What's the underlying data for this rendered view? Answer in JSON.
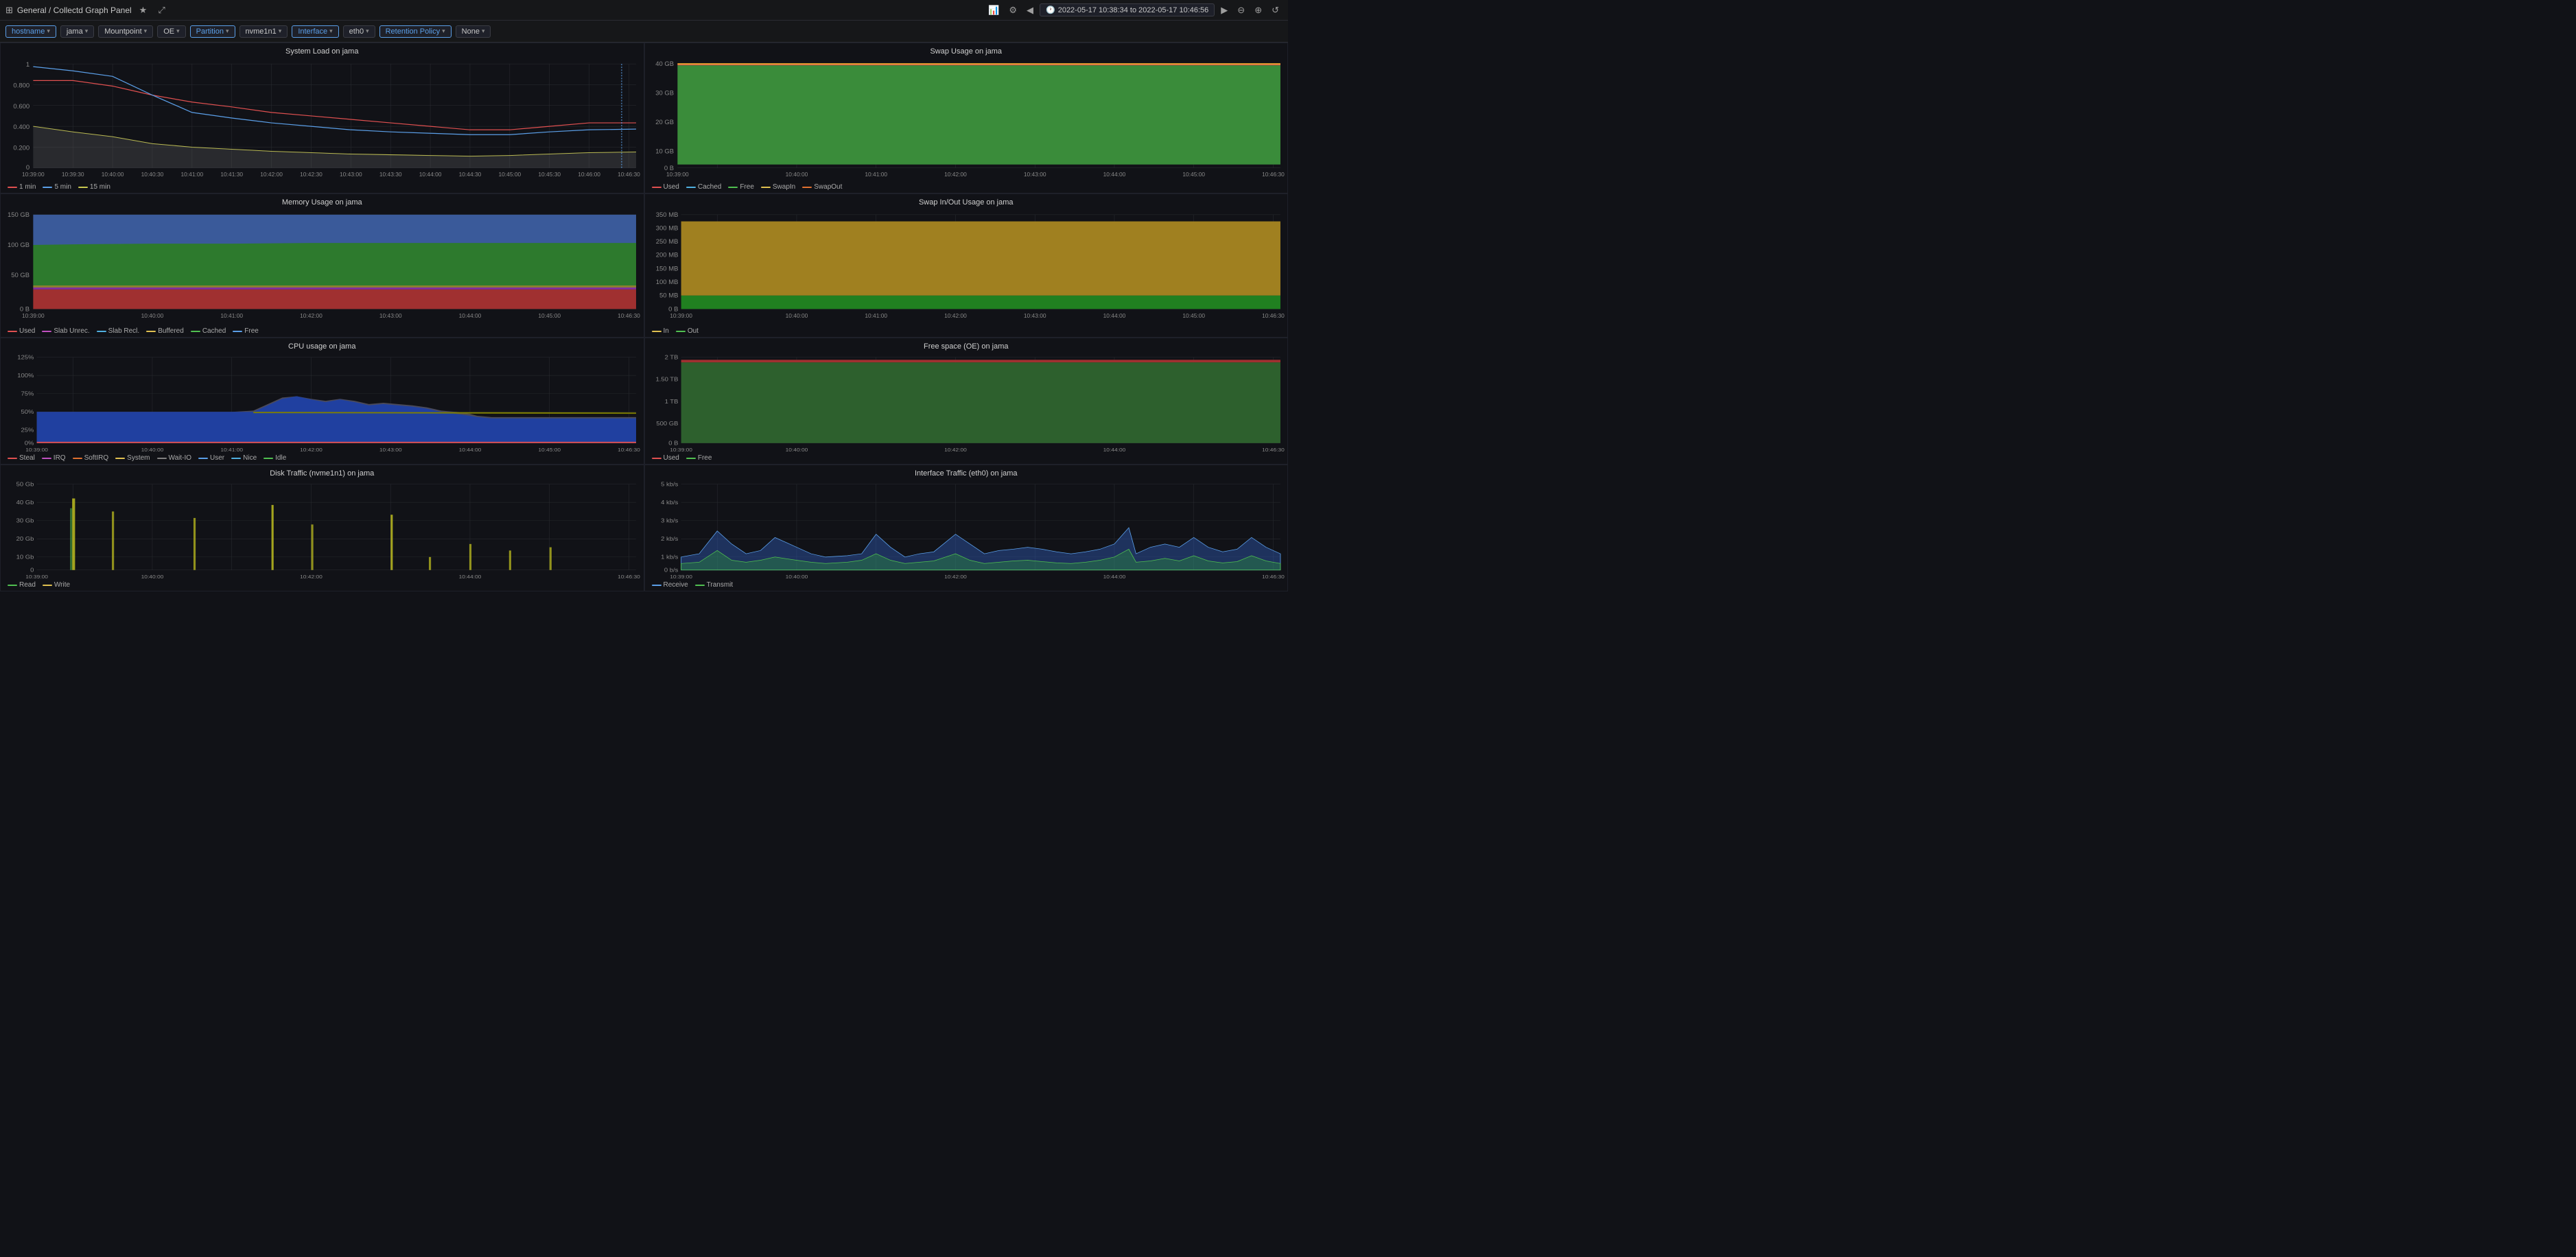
{
  "topbar": {
    "title": "General / Collectd Graph Panel",
    "star_icon": "★",
    "share_icon": "⤢",
    "time_range": "2022-05-17 10:38:34 to 2022-05-17 10:46:56",
    "zoom_in": "⊕",
    "refresh": "↺"
  },
  "filters": [
    {
      "id": "hostname",
      "label": "hostname",
      "value": "",
      "active": true
    },
    {
      "id": "jama",
      "label": "jama",
      "value": "",
      "active": false
    },
    {
      "id": "mountpoint",
      "label": "Mountpoint",
      "value": "",
      "active": false
    },
    {
      "id": "oe",
      "label": "OE",
      "value": "",
      "active": false
    },
    {
      "id": "partition",
      "label": "Partition",
      "value": "",
      "active": true
    },
    {
      "id": "nvme1n1",
      "label": "nvme1n1",
      "value": "",
      "active": false
    },
    {
      "id": "interface",
      "label": "Interface",
      "value": "",
      "active": true
    },
    {
      "id": "eth0",
      "label": "eth0",
      "value": "",
      "active": false
    },
    {
      "id": "retention",
      "label": "Retention Policy",
      "value": "",
      "active": true
    },
    {
      "id": "none",
      "label": "None",
      "value": "",
      "active": false
    }
  ],
  "panels": {
    "system_load": {
      "title": "System Load on jama",
      "y_labels": [
        "1",
        "0.800",
        "0.600",
        "0.400",
        "0.200",
        "0"
      ],
      "x_labels": [
        "10:39:00",
        "10:39:30",
        "10:40:00",
        "10:40:30",
        "10:41:00",
        "10:41:30",
        "10:42:00",
        "10:42:30",
        "10:43:00",
        "10:43:30",
        "10:44:00",
        "10:44:30",
        "10:45:00",
        "10:45:30",
        "10:46:00",
        "10:46:30"
      ],
      "legend": [
        {
          "label": "1 min",
          "color": "#e05050"
        },
        {
          "label": "5 min",
          "color": "#5b9fe8"
        },
        {
          "label": "15 min",
          "color": "#50c050"
        }
      ]
    },
    "swap_usage": {
      "title": "Swap Usage on jama",
      "y_labels": [
        "40 GB",
        "30 GB",
        "20 GB",
        "10 GB",
        "0 B"
      ],
      "legend": [
        {
          "label": "Used",
          "color": "#e05050"
        },
        {
          "label": "Cached",
          "color": "#50b0e0"
        },
        {
          "label": "Free",
          "color": "#50c050"
        },
        {
          "label": "SwapIn",
          "color": "#e0c050"
        },
        {
          "label": "SwapOut",
          "color": "#e07030"
        }
      ]
    },
    "memory_usage": {
      "title": "Memory Usage on jama",
      "y_labels": [
        "150 GB",
        "100 GB",
        "50 GB",
        "0 B"
      ],
      "legend": [
        {
          "label": "Used",
          "color": "#e05050"
        },
        {
          "label": "Slab Unrec.",
          "color": "#c050c0"
        },
        {
          "label": "Slab Recl.",
          "color": "#50b0e0"
        },
        {
          "label": "Buffered",
          "color": "#e0c050"
        },
        {
          "label": "Cached",
          "color": "#50c050"
        },
        {
          "label": "Free",
          "color": "#5b9fe8"
        }
      ]
    },
    "swap_inout": {
      "title": "Swap In/Out Usage on jama",
      "y_labels": [
        "350 MB",
        "300 MB",
        "250 MB",
        "200 MB",
        "150 MB",
        "100 MB",
        "50 MB",
        "0 B"
      ],
      "legend": [
        {
          "label": "In",
          "color": "#e0c050"
        },
        {
          "label": "Out",
          "color": "#50c050"
        }
      ]
    },
    "cpu_usage": {
      "title": "CPU usage on jama",
      "y_labels": [
        "125%",
        "100%",
        "75%",
        "50%",
        "25%",
        "0%"
      ],
      "legend": [
        {
          "label": "Steal",
          "color": "#e05050"
        },
        {
          "label": "IRQ",
          "color": "#c050c0"
        },
        {
          "label": "SoftIRQ",
          "color": "#e07030"
        },
        {
          "label": "System",
          "color": "#e0c050"
        },
        {
          "label": "Wait-IO",
          "color": "#808080"
        },
        {
          "label": "User",
          "color": "#5b9fe8"
        },
        {
          "label": "Nice",
          "color": "#50b0e0"
        },
        {
          "label": "Idle",
          "color": "#50c050"
        }
      ]
    },
    "free_space": {
      "title": "Free space (OE) on jama",
      "y_labels": [
        "2 TB",
        "1.50 TB",
        "1 TB",
        "500 GB",
        "0 B"
      ],
      "legend": [
        {
          "label": "Used",
          "color": "#e05050"
        },
        {
          "label": "Free",
          "color": "#50c050"
        }
      ]
    },
    "disk_traffic": {
      "title": "Disk Traffic (nvme1n1) on jama",
      "y_labels": [
        "50 Gb",
        "40 Gb",
        "30 Gb",
        "20 Gb",
        "10 Gb",
        "0"
      ],
      "legend": [
        {
          "label": "Read",
          "color": "#50c050"
        },
        {
          "label": "Write",
          "color": "#e0c050"
        }
      ]
    },
    "interface_traffic": {
      "title": "Interface Traffic (eth0) on jama",
      "y_labels": [
        "5 kb/s",
        "4 kb/s",
        "3 kb/s",
        "2 kb/s",
        "1 kb/s",
        "0 b/s"
      ],
      "legend": [
        {
          "label": "Receive",
          "color": "#5b9fe8"
        },
        {
          "label": "Transmit",
          "color": "#50c050"
        }
      ]
    }
  }
}
